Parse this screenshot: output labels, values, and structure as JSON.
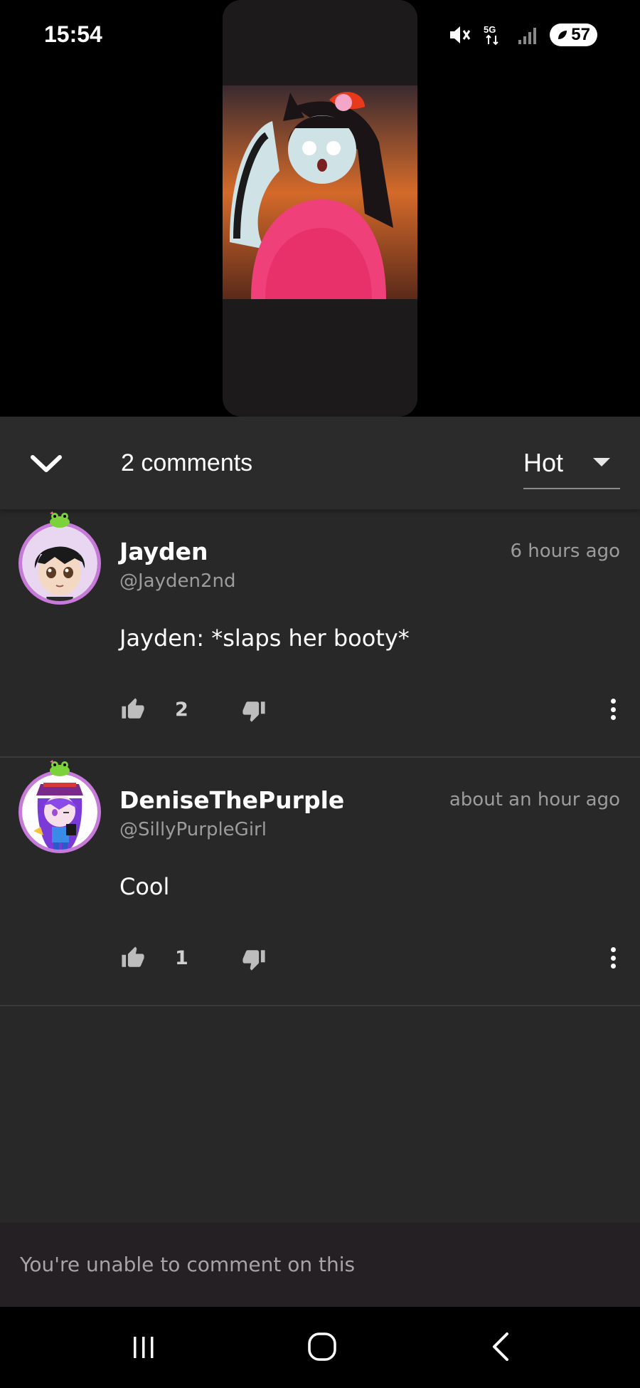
{
  "status_bar": {
    "time": "15:54",
    "battery": "57"
  },
  "panel": {
    "comment_count": "2 comments",
    "sort": {
      "selected": "Hot"
    }
  },
  "comments": [
    {
      "author": "Jayden",
      "handle": "@Jayden2nd",
      "time": "6 hours ago",
      "text": "Jayden: *slaps her booty*",
      "likes": "2",
      "avatar_border": "#c77ad9"
    },
    {
      "author": "DeniseThePurple",
      "handle": "@SillyPurpleGirl",
      "time": "about an hour ago",
      "text": "Cool",
      "likes": "1",
      "avatar_border": "#c77ad9"
    }
  ],
  "footer": {
    "notice": "You're unable to comment on this"
  },
  "colors": {
    "panel_bg": "#282828",
    "header_bg": "#2b2b2b",
    "footer_bg": "#242024",
    "muted_text": "#9c9c9c"
  },
  "icons": {
    "collapse": "chevron-down-icon",
    "like": "thumbs-up-icon",
    "dislike": "thumbs-down-icon",
    "more": "more-vertical-icon",
    "nav_recent": "recent-apps-icon",
    "nav_home": "home-icon",
    "nav_back": "back-icon"
  }
}
